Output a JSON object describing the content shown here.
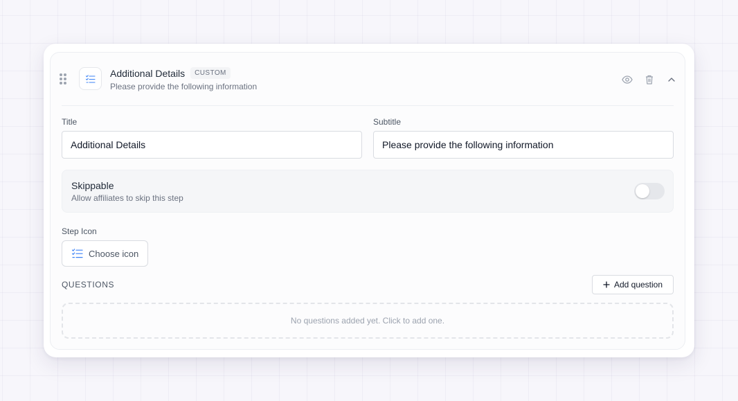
{
  "step": {
    "title": "Additional Details",
    "badge": "CUSTOM",
    "subtitle": "Please provide the following information",
    "icon": "list-checks-icon"
  },
  "header_actions": [
    "eye-icon",
    "trash-icon",
    "chevron-up-icon"
  ],
  "form": {
    "title_label": "Title",
    "title_value": "Additional Details",
    "subtitle_label": "Subtitle",
    "subtitle_value": "Please provide the following information"
  },
  "skippable": {
    "title": "Skippable",
    "description": "Allow affiliates to skip this step",
    "enabled": false
  },
  "step_icon": {
    "label": "Step Icon",
    "button_label": "Choose icon"
  },
  "questions": {
    "label": "QUESTIONS",
    "add_label": "Add question",
    "empty_text": "No questions added yet. Click to add one."
  },
  "colors": {
    "accent_icon": "#3b82f6",
    "toggle_off": "#e5e7eb"
  }
}
